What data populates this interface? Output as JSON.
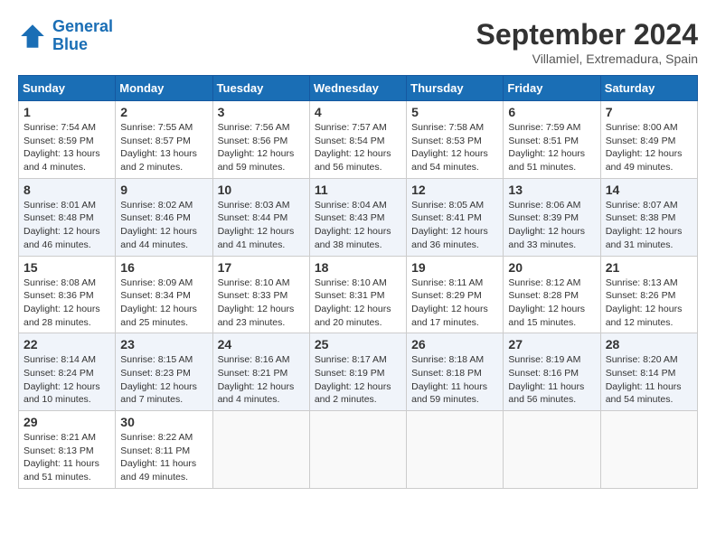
{
  "header": {
    "logo_line1": "General",
    "logo_line2": "Blue",
    "month": "September 2024",
    "location": "Villamiel, Extremadura, Spain"
  },
  "weekdays": [
    "Sunday",
    "Monday",
    "Tuesday",
    "Wednesday",
    "Thursday",
    "Friday",
    "Saturday"
  ],
  "weeks": [
    [
      {
        "day": "1",
        "info": "Sunrise: 7:54 AM\nSunset: 8:59 PM\nDaylight: 13 hours\nand 4 minutes."
      },
      {
        "day": "2",
        "info": "Sunrise: 7:55 AM\nSunset: 8:57 PM\nDaylight: 13 hours\nand 2 minutes."
      },
      {
        "day": "3",
        "info": "Sunrise: 7:56 AM\nSunset: 8:56 PM\nDaylight: 12 hours\nand 59 minutes."
      },
      {
        "day": "4",
        "info": "Sunrise: 7:57 AM\nSunset: 8:54 PM\nDaylight: 12 hours\nand 56 minutes."
      },
      {
        "day": "5",
        "info": "Sunrise: 7:58 AM\nSunset: 8:53 PM\nDaylight: 12 hours\nand 54 minutes."
      },
      {
        "day": "6",
        "info": "Sunrise: 7:59 AM\nSunset: 8:51 PM\nDaylight: 12 hours\nand 51 minutes."
      },
      {
        "day": "7",
        "info": "Sunrise: 8:00 AM\nSunset: 8:49 PM\nDaylight: 12 hours\nand 49 minutes."
      }
    ],
    [
      {
        "day": "8",
        "info": "Sunrise: 8:01 AM\nSunset: 8:48 PM\nDaylight: 12 hours\nand 46 minutes."
      },
      {
        "day": "9",
        "info": "Sunrise: 8:02 AM\nSunset: 8:46 PM\nDaylight: 12 hours\nand 44 minutes."
      },
      {
        "day": "10",
        "info": "Sunrise: 8:03 AM\nSunset: 8:44 PM\nDaylight: 12 hours\nand 41 minutes."
      },
      {
        "day": "11",
        "info": "Sunrise: 8:04 AM\nSunset: 8:43 PM\nDaylight: 12 hours\nand 38 minutes."
      },
      {
        "day": "12",
        "info": "Sunrise: 8:05 AM\nSunset: 8:41 PM\nDaylight: 12 hours\nand 36 minutes."
      },
      {
        "day": "13",
        "info": "Sunrise: 8:06 AM\nSunset: 8:39 PM\nDaylight: 12 hours\nand 33 minutes."
      },
      {
        "day": "14",
        "info": "Sunrise: 8:07 AM\nSunset: 8:38 PM\nDaylight: 12 hours\nand 31 minutes."
      }
    ],
    [
      {
        "day": "15",
        "info": "Sunrise: 8:08 AM\nSunset: 8:36 PM\nDaylight: 12 hours\nand 28 minutes."
      },
      {
        "day": "16",
        "info": "Sunrise: 8:09 AM\nSunset: 8:34 PM\nDaylight: 12 hours\nand 25 minutes."
      },
      {
        "day": "17",
        "info": "Sunrise: 8:10 AM\nSunset: 8:33 PM\nDaylight: 12 hours\nand 23 minutes."
      },
      {
        "day": "18",
        "info": "Sunrise: 8:10 AM\nSunset: 8:31 PM\nDaylight: 12 hours\nand 20 minutes."
      },
      {
        "day": "19",
        "info": "Sunrise: 8:11 AM\nSunset: 8:29 PM\nDaylight: 12 hours\nand 17 minutes."
      },
      {
        "day": "20",
        "info": "Sunrise: 8:12 AM\nSunset: 8:28 PM\nDaylight: 12 hours\nand 15 minutes."
      },
      {
        "day": "21",
        "info": "Sunrise: 8:13 AM\nSunset: 8:26 PM\nDaylight: 12 hours\nand 12 minutes."
      }
    ],
    [
      {
        "day": "22",
        "info": "Sunrise: 8:14 AM\nSunset: 8:24 PM\nDaylight: 12 hours\nand 10 minutes."
      },
      {
        "day": "23",
        "info": "Sunrise: 8:15 AM\nSunset: 8:23 PM\nDaylight: 12 hours\nand 7 minutes."
      },
      {
        "day": "24",
        "info": "Sunrise: 8:16 AM\nSunset: 8:21 PM\nDaylight: 12 hours\nand 4 minutes."
      },
      {
        "day": "25",
        "info": "Sunrise: 8:17 AM\nSunset: 8:19 PM\nDaylight: 12 hours\nand 2 minutes."
      },
      {
        "day": "26",
        "info": "Sunrise: 8:18 AM\nSunset: 8:18 PM\nDaylight: 11 hours\nand 59 minutes."
      },
      {
        "day": "27",
        "info": "Sunrise: 8:19 AM\nSunset: 8:16 PM\nDaylight: 11 hours\nand 56 minutes."
      },
      {
        "day": "28",
        "info": "Sunrise: 8:20 AM\nSunset: 8:14 PM\nDaylight: 11 hours\nand 54 minutes."
      }
    ],
    [
      {
        "day": "29",
        "info": "Sunrise: 8:21 AM\nSunset: 8:13 PM\nDaylight: 11 hours\nand 51 minutes."
      },
      {
        "day": "30",
        "info": "Sunrise: 8:22 AM\nSunset: 8:11 PM\nDaylight: 11 hours\nand 49 minutes."
      },
      {
        "day": "",
        "info": ""
      },
      {
        "day": "",
        "info": ""
      },
      {
        "day": "",
        "info": ""
      },
      {
        "day": "",
        "info": ""
      },
      {
        "day": "",
        "info": ""
      }
    ]
  ]
}
